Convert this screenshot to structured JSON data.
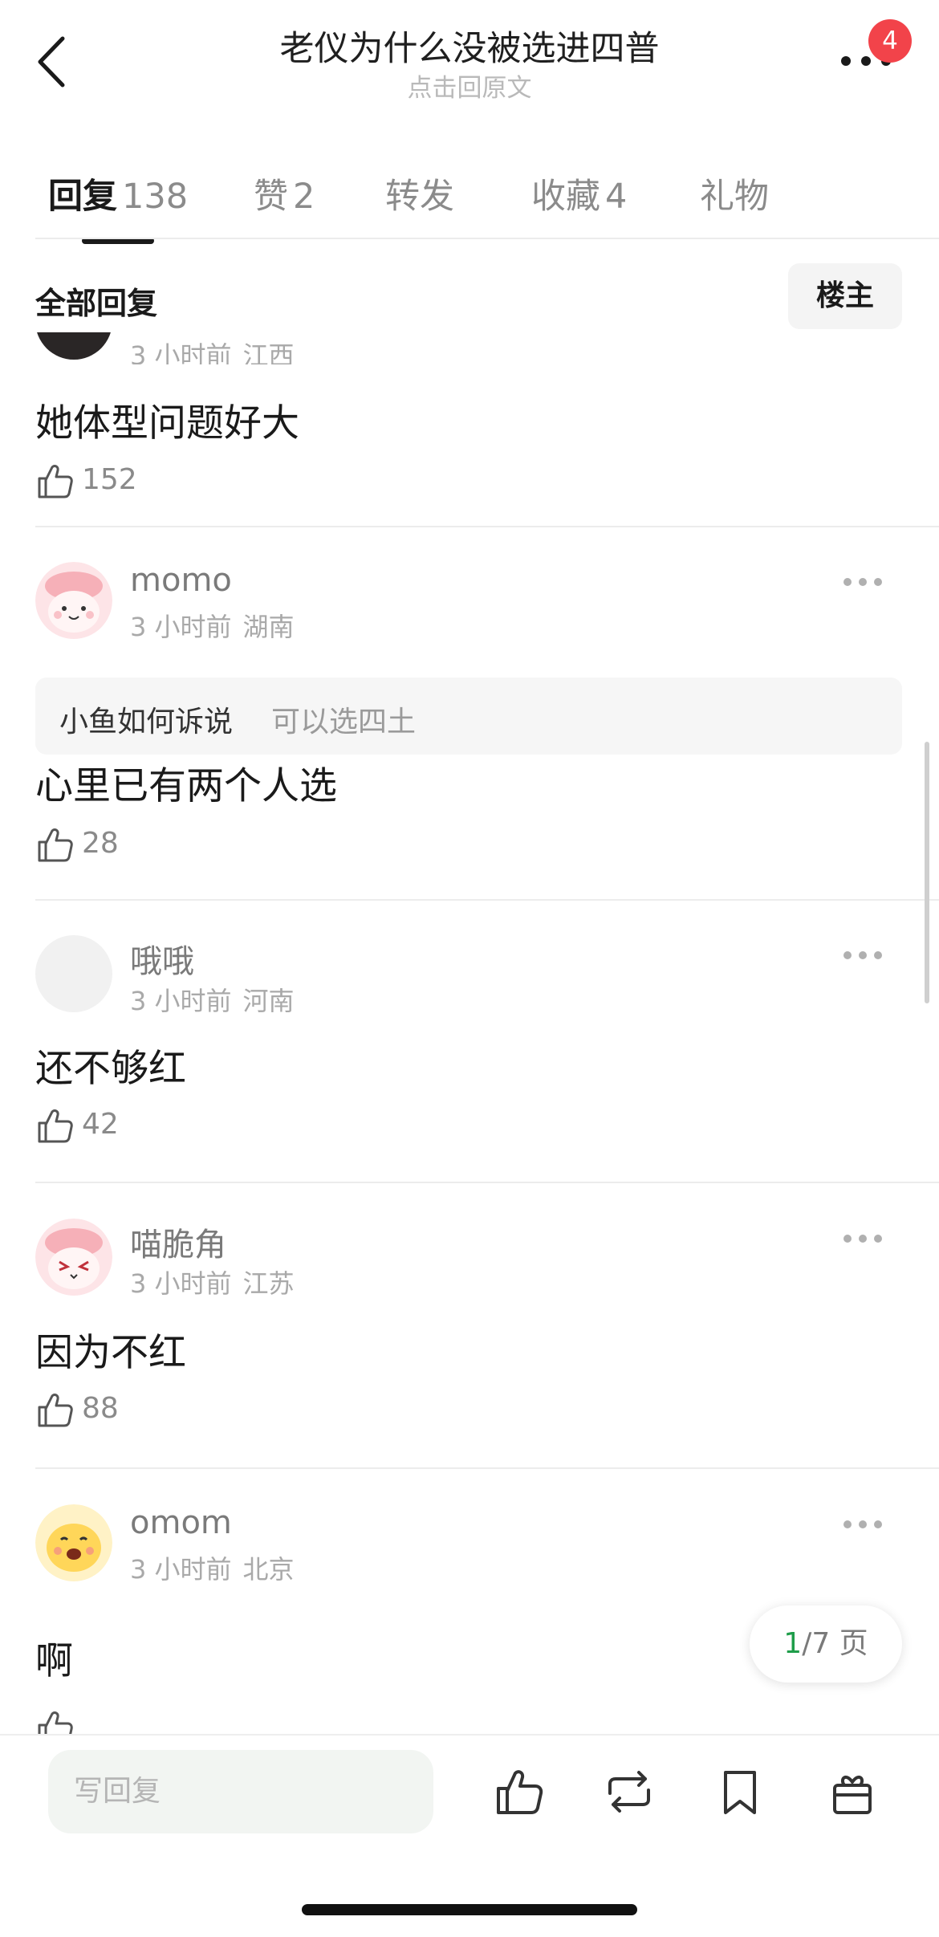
{
  "header": {
    "title": "老仪为什么没被选进四普",
    "subtitle": "点击回原文",
    "notification_count": "4"
  },
  "tabs": [
    {
      "label": "回复",
      "count": "138"
    },
    {
      "label": "赞",
      "count": "2"
    },
    {
      "label": "转发",
      "count": ""
    },
    {
      "label": "收藏",
      "count": "4"
    },
    {
      "label": "礼物",
      "count": ""
    }
  ],
  "section": {
    "title": "全部回复",
    "owner_button": "楼主"
  },
  "comments": [
    {
      "name": "",
      "time": "3 小时前",
      "location": "江西",
      "text": "她体型问题好大",
      "likes": "152"
    },
    {
      "name": "momo",
      "time": "3 小时前",
      "location": "湖南",
      "quote_name": "小鱼如何诉说",
      "quote_text": "可以选四土",
      "text": "心里已有两个人选",
      "likes": "28"
    },
    {
      "name": "哦哦",
      "time": "3 小时前",
      "location": "河南",
      "text": "还不够红",
      "likes": "42"
    },
    {
      "name": "喵脆角",
      "time": "3 小时前",
      "location": "江苏",
      "text": "因为不红",
      "likes": "88"
    },
    {
      "name": "omom",
      "time": "3 小时前",
      "location": "北京",
      "text": "啊",
      "likes": ""
    }
  ],
  "pagination": {
    "current": "1",
    "total": "/7 页"
  },
  "bottom_bar": {
    "reply_placeholder": "写回复",
    "icons": [
      "like-icon",
      "repost-icon",
      "bookmark-icon",
      "gift-icon"
    ]
  }
}
